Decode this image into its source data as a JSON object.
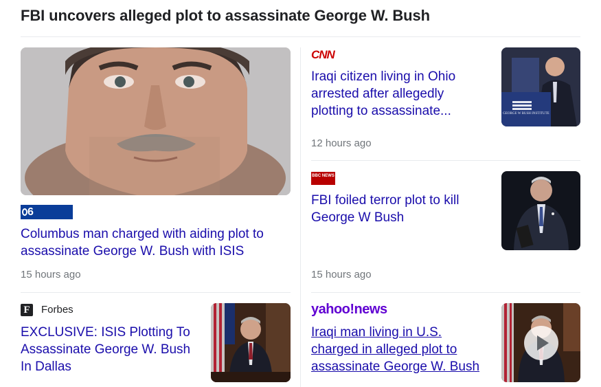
{
  "page": {
    "title": "FBI uncovers alleged plot to assassinate George W. Bush"
  },
  "articles": [
    {
      "source": "6",
      "headline": "Columbus man charged with aiding plot to assassinate George W. Bush with ISIS",
      "time": "15 hours ago",
      "image": "mugshot-photo"
    },
    {
      "source": "CNN",
      "headline": "Iraqi citizen living in Ohio arrested after allegedly plotting to assassinate...",
      "time": "12 hours ago",
      "image": "podium-photo",
      "image_caption": "GEORGE W BUSH INSTITUTE"
    },
    {
      "source": "BBC NEWS",
      "headline": "FBI foiled terror plot to kill George W Bush",
      "time": "15 hours ago",
      "image": "suit-portrait-photo"
    },
    {
      "source": "Forbes",
      "source_icon": "F",
      "headline": "EXCLUSIVE: ISIS Plotting To Assassinate George W. Bush In Dallas",
      "image": "oval-office-photo"
    },
    {
      "source": "yahoo!news",
      "headline": "Iraqi man living in U.S. charged in alleged plot to assassinate George W. Bush",
      "image": "video-thumbnail",
      "image_icon": "play-icon"
    }
  ],
  "colors": {
    "link": "#1a0dab",
    "meta": "#70757a",
    "cnn": "#cc0000",
    "bbc": "#b80000",
    "yahoo": "#6001d2",
    "wbns": "#0a3d99"
  }
}
